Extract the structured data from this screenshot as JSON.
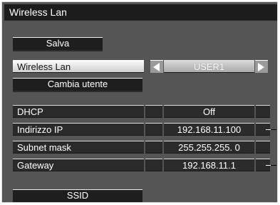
{
  "window": {
    "title": "Wireless Lan"
  },
  "buttons": {
    "save": "Salva",
    "change_user": "Cambia utente",
    "ssid": "SSID"
  },
  "profile_row": {
    "label": "Wireless Lan",
    "value": "USER1"
  },
  "settings": [
    {
      "label": "DHCP",
      "value": "Off"
    },
    {
      "label": "Indirizzo IP",
      "value": "192.168.11.100"
    },
    {
      "label": "Subnet mask",
      "value": "255.255.255. 0"
    },
    {
      "label": "Gateway",
      "value": "192.168.11.1"
    }
  ],
  "icons": {
    "prev": "arrow-left-icon",
    "next": "arrow-right-icon"
  },
  "colors": {
    "panel": "#555555",
    "title_bar": "#1c1c1c",
    "selected_row": "#e6e6e6"
  }
}
